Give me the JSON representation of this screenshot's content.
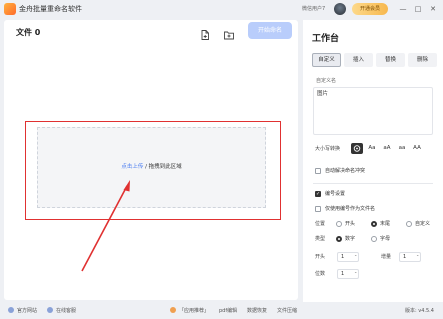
{
  "app": {
    "title": "金舟批量重命名软件",
    "user_label": "微信用户7",
    "vip_label": "开通会员",
    "window_controls": {
      "minimize": "—",
      "maximize": "□",
      "close": "✕"
    }
  },
  "main": {
    "file_count_label": "文件 0",
    "start_button": "开始命名",
    "drop_zone": {
      "link_text": "点击上传",
      "text": " / 拖拽到此区域"
    }
  },
  "bottom_bar": {
    "official_site": "官方网站",
    "online_service": "在线客服",
    "recommend": "「应用推荐」",
    "pdf_editor": "pdf编辑",
    "data_recovery": "数据恢复",
    "file_compress": "文件压缩"
  },
  "workbench": {
    "title": "工作台",
    "tabs": [
      "自定义",
      "插入",
      "替换",
      "删除"
    ],
    "custom_name_label": "自定义名",
    "custom_name_value": "图片",
    "case_label": "大小写转换",
    "case_options": [
      "Aa",
      "aA",
      "aa",
      "AA"
    ],
    "auto_resolve_conflict": "自动解决命名冲突",
    "numbering_settings": "编号设置",
    "use_number_only": "仅使用编号作为文件名",
    "position_label": "位置",
    "position_options": [
      "开头",
      "末尾",
      "自定义"
    ],
    "type_label": "类型",
    "type_options": [
      "数字",
      "字母"
    ],
    "start_label": "开头",
    "start_value": "1",
    "increment_label": "增量",
    "increment_value": "1",
    "digits_label": "位数",
    "digits_value": "1"
  },
  "version": "版本: v4.5.4",
  "colors": {
    "accent": "#4a7cf0",
    "start_button_bg": "#b9cdfb",
    "annotation_red": "#e03131"
  }
}
